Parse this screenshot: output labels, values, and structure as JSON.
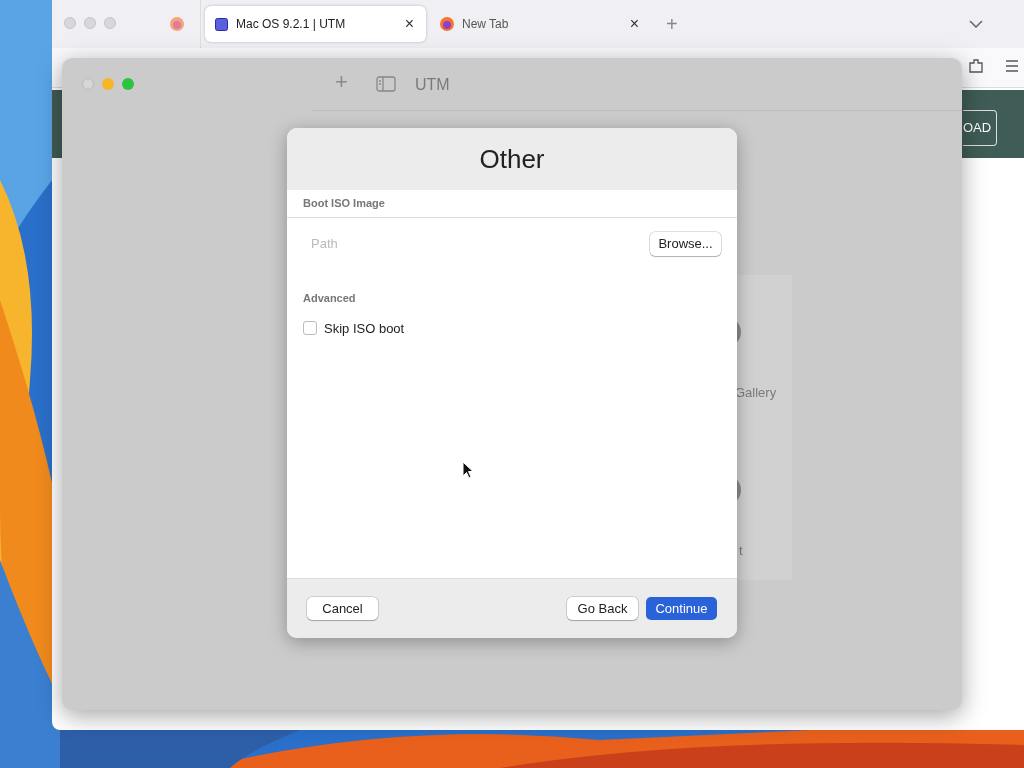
{
  "browser": {
    "tabs": [
      {
        "title": "Mac OS 9.2.1 | UTM",
        "selected": true,
        "close": "×"
      },
      {
        "title": "New Tab",
        "selected": false,
        "close": "×"
      }
    ],
    "new_tab": "+",
    "page_button": "OAD"
  },
  "utm": {
    "add": "+",
    "title": "UTM",
    "gallery_label": "Gallery",
    "column_2": "t"
  },
  "dialog": {
    "title": "Other",
    "section": "Boot ISO Image",
    "path": {
      "placeholder": "Path"
    },
    "browse": "Browse...",
    "advanced": "Advanced",
    "skip_iso": {
      "label": "Skip ISO boot",
      "checked": false
    },
    "buttons": [
      {
        "label": "Cancel",
        "kind": "secondary"
      },
      {
        "label": "Go Back",
        "kind": "secondary"
      },
      {
        "label": "Continue",
        "kind": "primary"
      }
    ]
  }
}
